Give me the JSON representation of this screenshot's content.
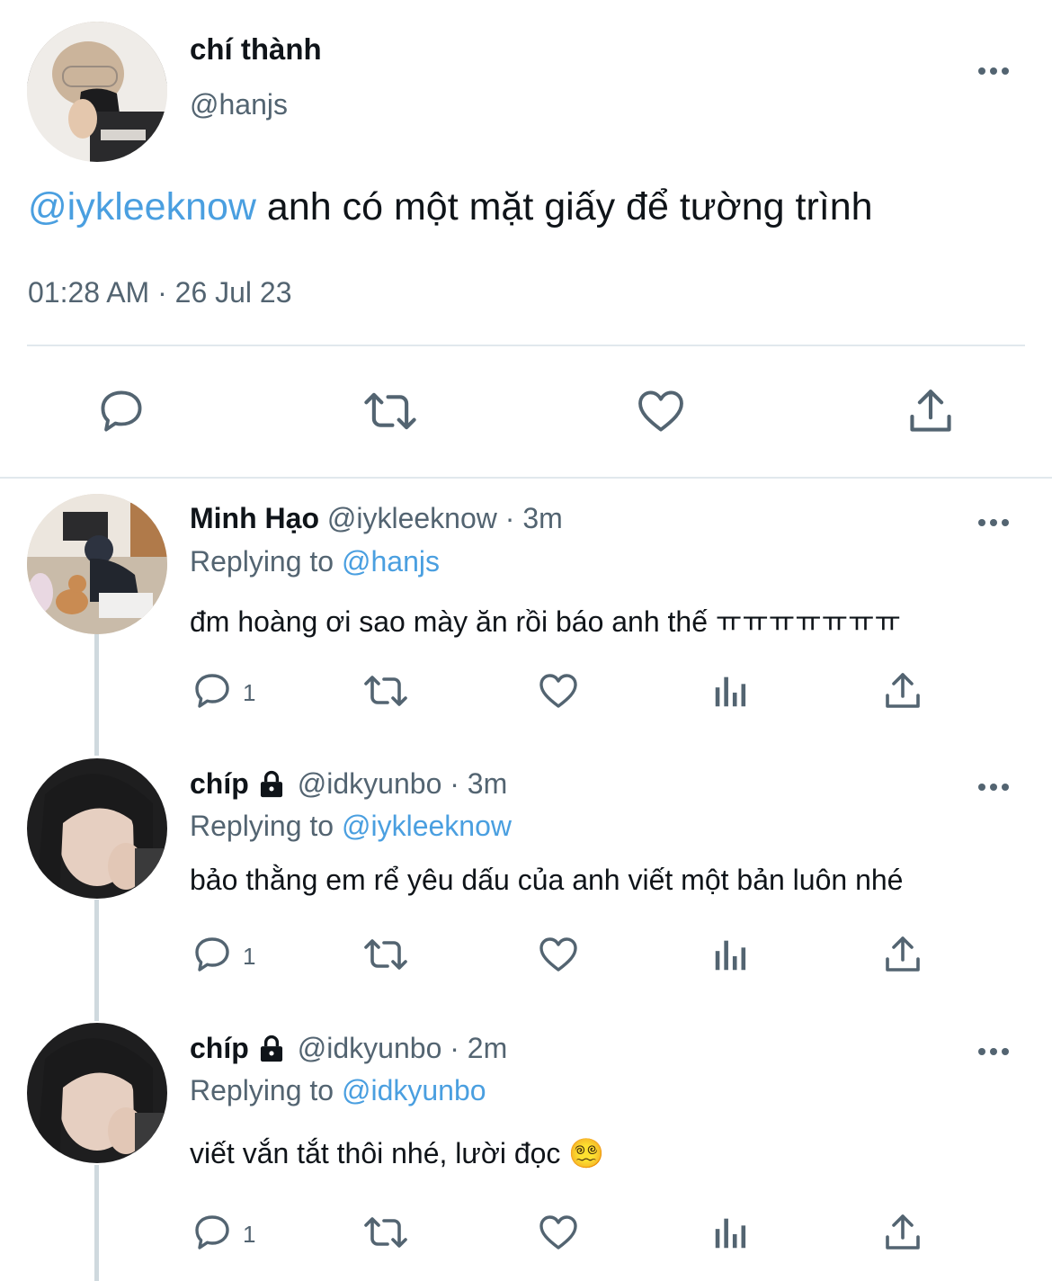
{
  "main_tweet": {
    "display_name": "chí thành",
    "handle": "@hanjs",
    "mention": "@iykleeknow",
    "text": " anh có một mặt giấy để tường trình",
    "timestamp": "01:28 AM · 26 Jul 23"
  },
  "replies": [
    {
      "display_name": "Minh Hạo",
      "handle_time": "@iykleeknow · 3m",
      "replying_label": "Replying to",
      "replying_to": "@hanjs",
      "text": "đm hoàng ơi sao mày ăn rồi báo anh thế ㅠㅠㅠㅠㅠㅠㅠ",
      "reply_count": "1",
      "locked": false
    },
    {
      "display_name": "chíp",
      "handle_time": "@idkyunbo · 3m",
      "replying_label": "Replying to",
      "replying_to": "@iykleeknow",
      "text": "bảo thằng em rể yêu dấu của anh viết một bản luôn nhé",
      "reply_count": "1",
      "locked": true
    },
    {
      "display_name": "chíp",
      "handle_time": "@idkyunbo · 2m",
      "replying_label": "Replying to",
      "replying_to": "@idkyunbo",
      "text": "viết vắn tắt thôi nhé, lười đọc 😵‍💫",
      "reply_count": "1",
      "locked": true
    }
  ],
  "icons": {
    "reply": "speech-bubble-icon",
    "retweet": "retweet-icon",
    "like": "heart-icon",
    "views": "bar-chart-icon",
    "share": "share-icon",
    "more": "more-dots-icon",
    "lock": "lock-icon"
  },
  "colors": {
    "link": "#4a9fe0",
    "muted": "#536471",
    "divider": "#e1e8ed"
  }
}
